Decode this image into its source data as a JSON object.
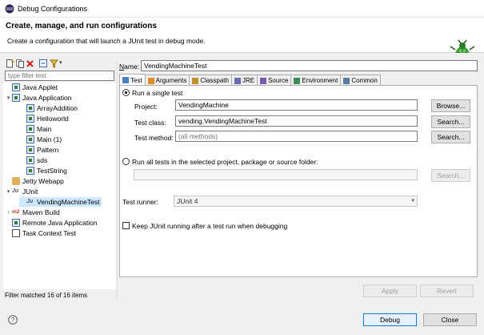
{
  "window": {
    "title": "Debug Configurations"
  },
  "banner": {
    "heading": "Create, manage, and run configurations",
    "subtitle": "Create a configuration that will launch a JUnit test in debug mode."
  },
  "sidebar": {
    "filter_placeholder": "type filter text",
    "tree": [
      {
        "label": "Java Applet",
        "icon": "java-applet-icon",
        "depth": 0,
        "expander": ""
      },
      {
        "label": "Java Application",
        "icon": "java-application-icon",
        "depth": 0,
        "expander": "▾"
      },
      {
        "label": "ArrayAddition",
        "icon": "java-application-icon",
        "depth": 1,
        "expander": ""
      },
      {
        "label": "Helloworld",
        "icon": "java-application-icon",
        "depth": 1,
        "expander": ""
      },
      {
        "label": "Main",
        "icon": "java-application-icon",
        "depth": 1,
        "expander": ""
      },
      {
        "label": "Main (1)",
        "icon": "java-application-icon",
        "depth": 1,
        "expander": ""
      },
      {
        "label": "Pattern",
        "icon": "java-application-icon",
        "depth": 1,
        "expander": ""
      },
      {
        "label": "sds",
        "icon": "java-application-icon",
        "depth": 1,
        "expander": ""
      },
      {
        "label": "TestString",
        "icon": "java-application-icon",
        "depth": 1,
        "expander": ""
      },
      {
        "label": "Jetty Webapp",
        "icon": "jetty-icon",
        "depth": 0,
        "expander": ""
      },
      {
        "label": "JUnit",
        "icon": "junit-icon",
        "depth": 0,
        "expander": "▾"
      },
      {
        "label": "VendingMachineTest",
        "icon": "junit-icon",
        "depth": 1,
        "expander": "",
        "selected": true
      },
      {
        "label": "Maven Build",
        "icon": "maven-icon",
        "depth": 0,
        "expander": "›"
      },
      {
        "label": "Remote Java Application",
        "icon": "remote-java-icon",
        "depth": 0,
        "expander": ""
      },
      {
        "label": "Task Context Test",
        "icon": "task-context-icon",
        "depth": 0,
        "expander": ""
      }
    ],
    "status": "Filter matched 16 of 16 items"
  },
  "editor": {
    "name_label": "Name:",
    "name_value": "VendingMachineTest",
    "tabs": [
      {
        "label": "Test",
        "icon": "junit-test-icon",
        "active": true
      },
      {
        "label": "Arguments",
        "icon": "arguments-icon"
      },
      {
        "label": "Classpath",
        "icon": "classpath-icon"
      },
      {
        "label": "JRE",
        "icon": "jre-icon"
      },
      {
        "label": "Source",
        "icon": "source-icon"
      },
      {
        "label": "Environment",
        "icon": "environment-icon"
      },
      {
        "label": "Common",
        "icon": "common-icon"
      }
    ],
    "run_single_label": "Run a single test",
    "project_label": "Project:",
    "project_value": "VendingMachine",
    "browse_label": "Browse...",
    "testclass_label": "Test class:",
    "testclass_value": "vending.VendingMachineTest",
    "search_label": "Search...",
    "testmethod_label": "Test method:",
    "testmethod_placeholder": "(all methods)",
    "run_all_label": "Run all tests in the selected project, package or source folder:",
    "container_value": "",
    "testrunner_label": "Test runner:",
    "testrunner_value": "JUnit 4",
    "keep_alive_label": "Keep JUnit running after a test run when debugging",
    "apply_label": "Apply",
    "revert_label": "Revert"
  },
  "footer": {
    "help_icon": "help-icon",
    "debug_label": "Debug",
    "close_label": "Close"
  }
}
